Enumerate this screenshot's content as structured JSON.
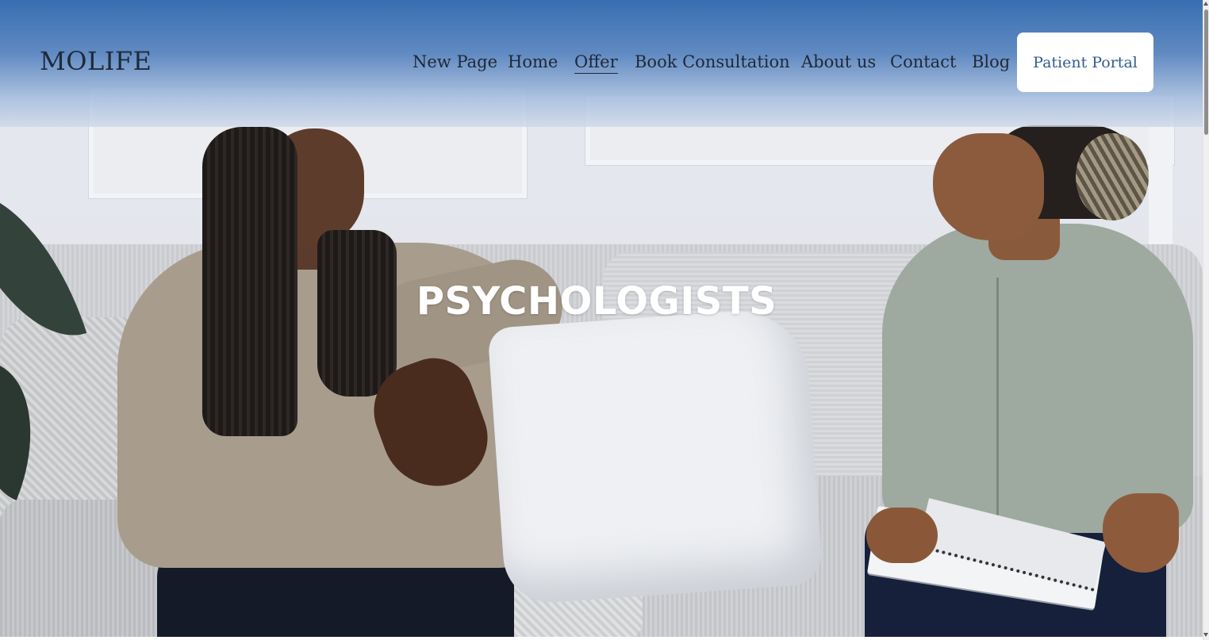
{
  "site": {
    "logo": "MOLIFE"
  },
  "nav": {
    "items": [
      {
        "label": "New Page"
      },
      {
        "label": "Home"
      },
      {
        "label": "Offer",
        "active": true
      },
      {
        "label": "Book Consultation"
      },
      {
        "label": "About us"
      },
      {
        "label": "Contact"
      },
      {
        "label": "Blog"
      }
    ],
    "cta_label": "Patient Portal"
  },
  "hero": {
    "title": "PSYCHOLOGISTS",
    "image_subject": "two people talking on a grey sofa"
  },
  "colors": {
    "header_top": "#346cb0",
    "header_bottom": "#cdd8e8",
    "nav_text": "#1f2836",
    "cta_text": "#2f5d95",
    "cta_bg": "#ffffff",
    "title_text": "#ffffff"
  }
}
